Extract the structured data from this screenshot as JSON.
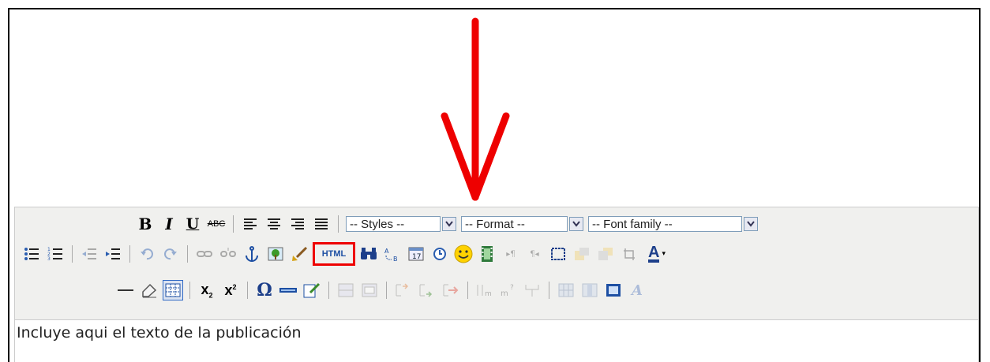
{
  "editor": {
    "selects": {
      "styles": "-- Styles --",
      "format": "-- Format --",
      "font_family": "-- Font family --"
    },
    "html_button_label": "HTML",
    "content_text": "Incluye aqui el texto de la publicación",
    "row1_icons": [
      "bold-icon",
      "italic-icon",
      "underline-icon",
      "strikethrough-icon",
      "align-left-icon",
      "align-center-icon",
      "align-right-icon",
      "align-justify-icon"
    ],
    "row2_icons": [
      "bullet-list-icon",
      "numbered-list-icon",
      "outdent-icon",
      "indent-icon",
      "undo-icon",
      "redo-icon",
      "link-icon",
      "unlink-icon",
      "anchor-icon",
      "image-icon",
      "cleanup-icon",
      "html-icon",
      "search-icon",
      "replace-icon",
      "insert-date-icon",
      "insert-time-icon",
      "emoticon-icon",
      "media-icon",
      "ltr-icon",
      "rtl-icon",
      "fullscreen-icon",
      "layer-forward-icon",
      "layer-backward-icon",
      "absolute-icon",
      "text-color-icon"
    ],
    "row3_icons": [
      "horizontal-rule-icon",
      "remove-format-icon",
      "visual-aid-icon",
      "subscript-icon",
      "superscript-icon",
      "charmap-icon",
      "advanced-hr-icon",
      "edit-icon",
      "row-before-icon",
      "row-after-icon",
      "delete-row-icon",
      "col-before-icon",
      "col-after-icon",
      "delete-col-icon",
      "table-props-icon",
      "cell-props-icon",
      "merge-cells-icon",
      "split-cells-icon"
    ]
  },
  "colors": {
    "arrow": "#e00000",
    "highlight_box": "#e00000",
    "toolbar_bg": "#f0f0ee"
  }
}
